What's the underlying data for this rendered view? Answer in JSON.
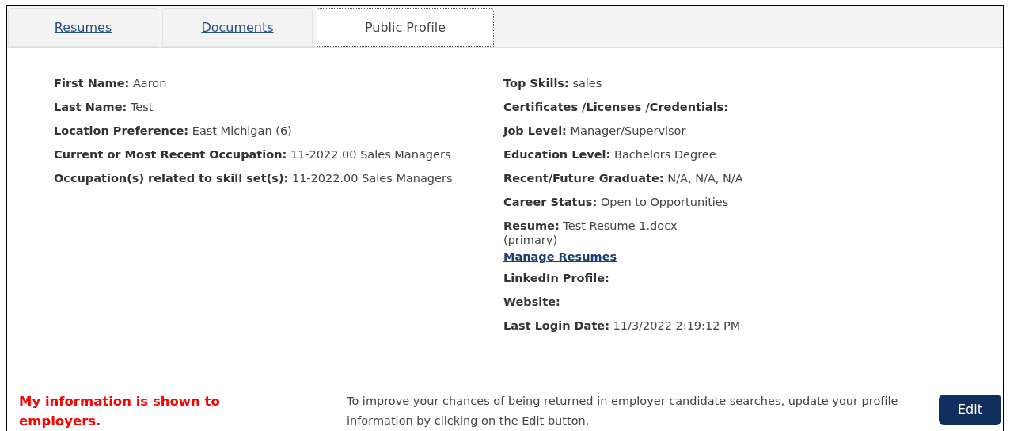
{
  "tabs": [
    {
      "label": "Resumes",
      "selected": false
    },
    {
      "label": "Documents",
      "selected": false
    },
    {
      "label": "Public Profile",
      "selected": true
    }
  ],
  "left_fields": [
    {
      "kind": "field",
      "label": "First Name:",
      "value": "Aaron"
    },
    {
      "kind": "field",
      "label": "Last Name:",
      "value": "Test"
    },
    {
      "kind": "field",
      "label": "Location Preference:",
      "value": "East Michigan (6)"
    },
    {
      "kind": "field",
      "label": "Current or Most Recent Occupation:",
      "value": "11-2022.00 Sales Managers"
    },
    {
      "kind": "field",
      "label": "Occupation(s) related to skill set(s):",
      "value": "11-2022.00 Sales Managers"
    }
  ],
  "right_fields": [
    {
      "kind": "field",
      "label": "Top Skills:",
      "value": "sales"
    },
    {
      "kind": "field",
      "label": "Certificates /Licenses /Credentials:"
    },
    {
      "kind": "field",
      "label": "Job Level:",
      "value": "Manager/Supervisor"
    },
    {
      "kind": "field",
      "label": "Education Level:",
      "value": "Bachelors Degree"
    },
    {
      "kind": "field",
      "label": "Recent/Future Graduate:",
      "value": "N/A, N/A, N/A"
    },
    {
      "kind": "field",
      "label": "Career Status:",
      "value": "Open to Opportunities"
    },
    {
      "kind": "field",
      "label": "Resume:",
      "value": "Test Resume 1.docx",
      "note": "(primary)"
    },
    {
      "kind": "link",
      "label": "Manage Resumes"
    },
    {
      "kind": "field",
      "label": "LinkedIn Profile:"
    },
    {
      "kind": "field",
      "label": "Website:"
    },
    {
      "kind": "field",
      "label": "Last Login Date:",
      "value": "11/3/2022 2:19:12 PM"
    }
  ],
  "footer": {
    "status": "My information is shown to employers.",
    "hint": "To improve your chances of being returned in employer candidate searches, update your profile information by clicking on the Edit button.",
    "button": "Edit"
  }
}
